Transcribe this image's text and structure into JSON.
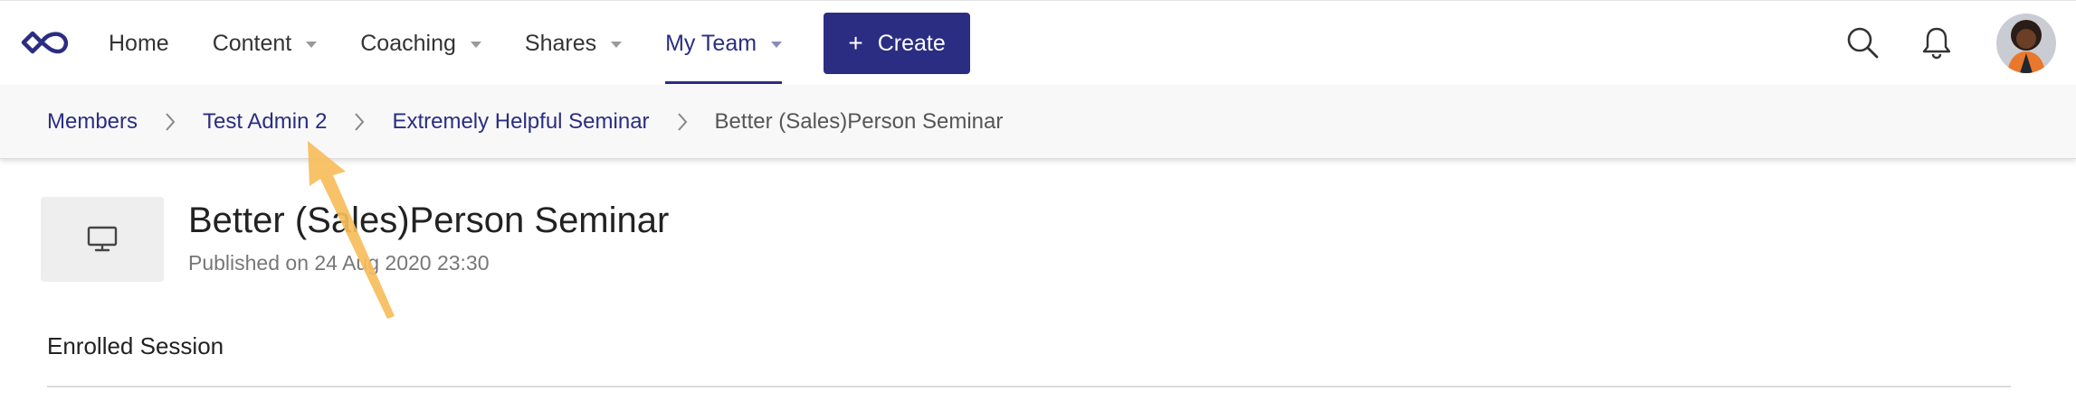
{
  "nav": {
    "items": [
      {
        "label": "Home",
        "has_caret": false,
        "active": false
      },
      {
        "label": "Content",
        "has_caret": true,
        "active": false
      },
      {
        "label": "Coaching",
        "has_caret": true,
        "active": false
      },
      {
        "label": "Shares",
        "has_caret": true,
        "active": false
      },
      {
        "label": "My Team",
        "has_caret": true,
        "active": true
      }
    ],
    "create_label": "Create"
  },
  "breadcrumb": {
    "items": [
      "Members",
      "Test Admin 2",
      "Extremely Helpful Seminar",
      "Better (Sales)Person Seminar"
    ]
  },
  "content": {
    "title": "Better (Sales)Person Seminar",
    "published": "Published on 24 Aug 2020 23:30",
    "section_heading": "Enrolled Session"
  },
  "icons": {
    "logo": "infinity-logo-icon",
    "search": "search-icon",
    "notifications": "bell-icon",
    "thumbnail": "monitor-icon",
    "breadcrumb_separator": "chevron-right-icon"
  },
  "colors": {
    "brand": "#2b2d83",
    "annotation_arrow": "#f7bd5c",
    "breadcrumb_bg": "#f8f8f8"
  }
}
